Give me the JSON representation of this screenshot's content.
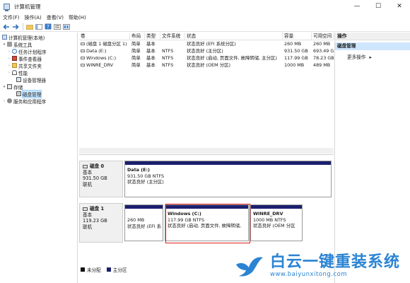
{
  "window": {
    "title": "计算机管理",
    "minimize": "—",
    "maximize": "☐",
    "close": "✕"
  },
  "menu": [
    "文件(F)",
    "操作(A)",
    "查看(V)",
    "帮助(H)"
  ],
  "tree": {
    "root": "计算机管理(本地)",
    "system_tools": "系统工具",
    "task_scheduler": "任务计划程序",
    "event_viewer": "事件查看器",
    "shared_folders": "共享文件夹",
    "performance": "性能",
    "device_manager": "设备管理器",
    "storage": "存储",
    "disk_management": "磁盘管理",
    "services_apps": "服务和应用程序"
  },
  "table": {
    "headers": [
      "卷",
      "布局",
      "类型",
      "文件系统",
      "状态",
      "容量",
      "可用空间"
    ],
    "rows": [
      [
        "(磁盘 1 磁盘分区 1)",
        "简单",
        "基本",
        "",
        "状态良好 (EFI 系统分区)",
        "260 MB",
        "260 MB"
      ],
      [
        "Data (E:)",
        "简单",
        "基本",
        "NTFS",
        "状态良好 (主分区)",
        "931.50 GB",
        "693.49 G"
      ],
      [
        "Windows (C:)",
        "简单",
        "基本",
        "NTFS",
        "状态良好 (启动, 页面文件, 故障转储, 主分区)",
        "117.99 GB",
        "78.23 GB"
      ],
      [
        "WINRE_DRV",
        "简单",
        "基本",
        "NTFS",
        "状态良好 (OEM 分区)",
        "1000 MB",
        "489 MB"
      ]
    ]
  },
  "disks": [
    {
      "name": "磁盘 0",
      "type": "基本",
      "size": "931.50 GB",
      "status": "联机",
      "partitions": [
        {
          "name": "Data  (E:)",
          "size": "931.50 GB NTFS",
          "status": "状态良好 (主分区)"
        }
      ]
    },
    {
      "name": "磁盘 1",
      "type": "基本",
      "size": "119.23 GB",
      "status": "联机",
      "partitions": [
        {
          "name": "",
          "size": "260 MB",
          "status": "状态良好 (EFI 系"
        },
        {
          "name": "Windows  (C:)",
          "size": "117.99 GB NTFS",
          "status": "状态良好 (启动, 页面文件, 故障转储,"
        },
        {
          "name": "WINRE_DRV",
          "size": "1000 MB NTFS",
          "status": "状态良好 (OEM 分区"
        }
      ]
    }
  ],
  "legend": {
    "unallocated": "未分配",
    "primary": "主分区"
  },
  "actions": {
    "header": "操作",
    "section": "磁盘管理",
    "more": "更多操作"
  },
  "watermark": {
    "name": "白云一键重装系统",
    "url": "www.baiyunxitong.com"
  },
  "colors": {
    "partition_bar": "#1b1f6e",
    "highlight": "#e02020",
    "selection": "#cfe6ff",
    "watermark": "#2a83d3"
  }
}
